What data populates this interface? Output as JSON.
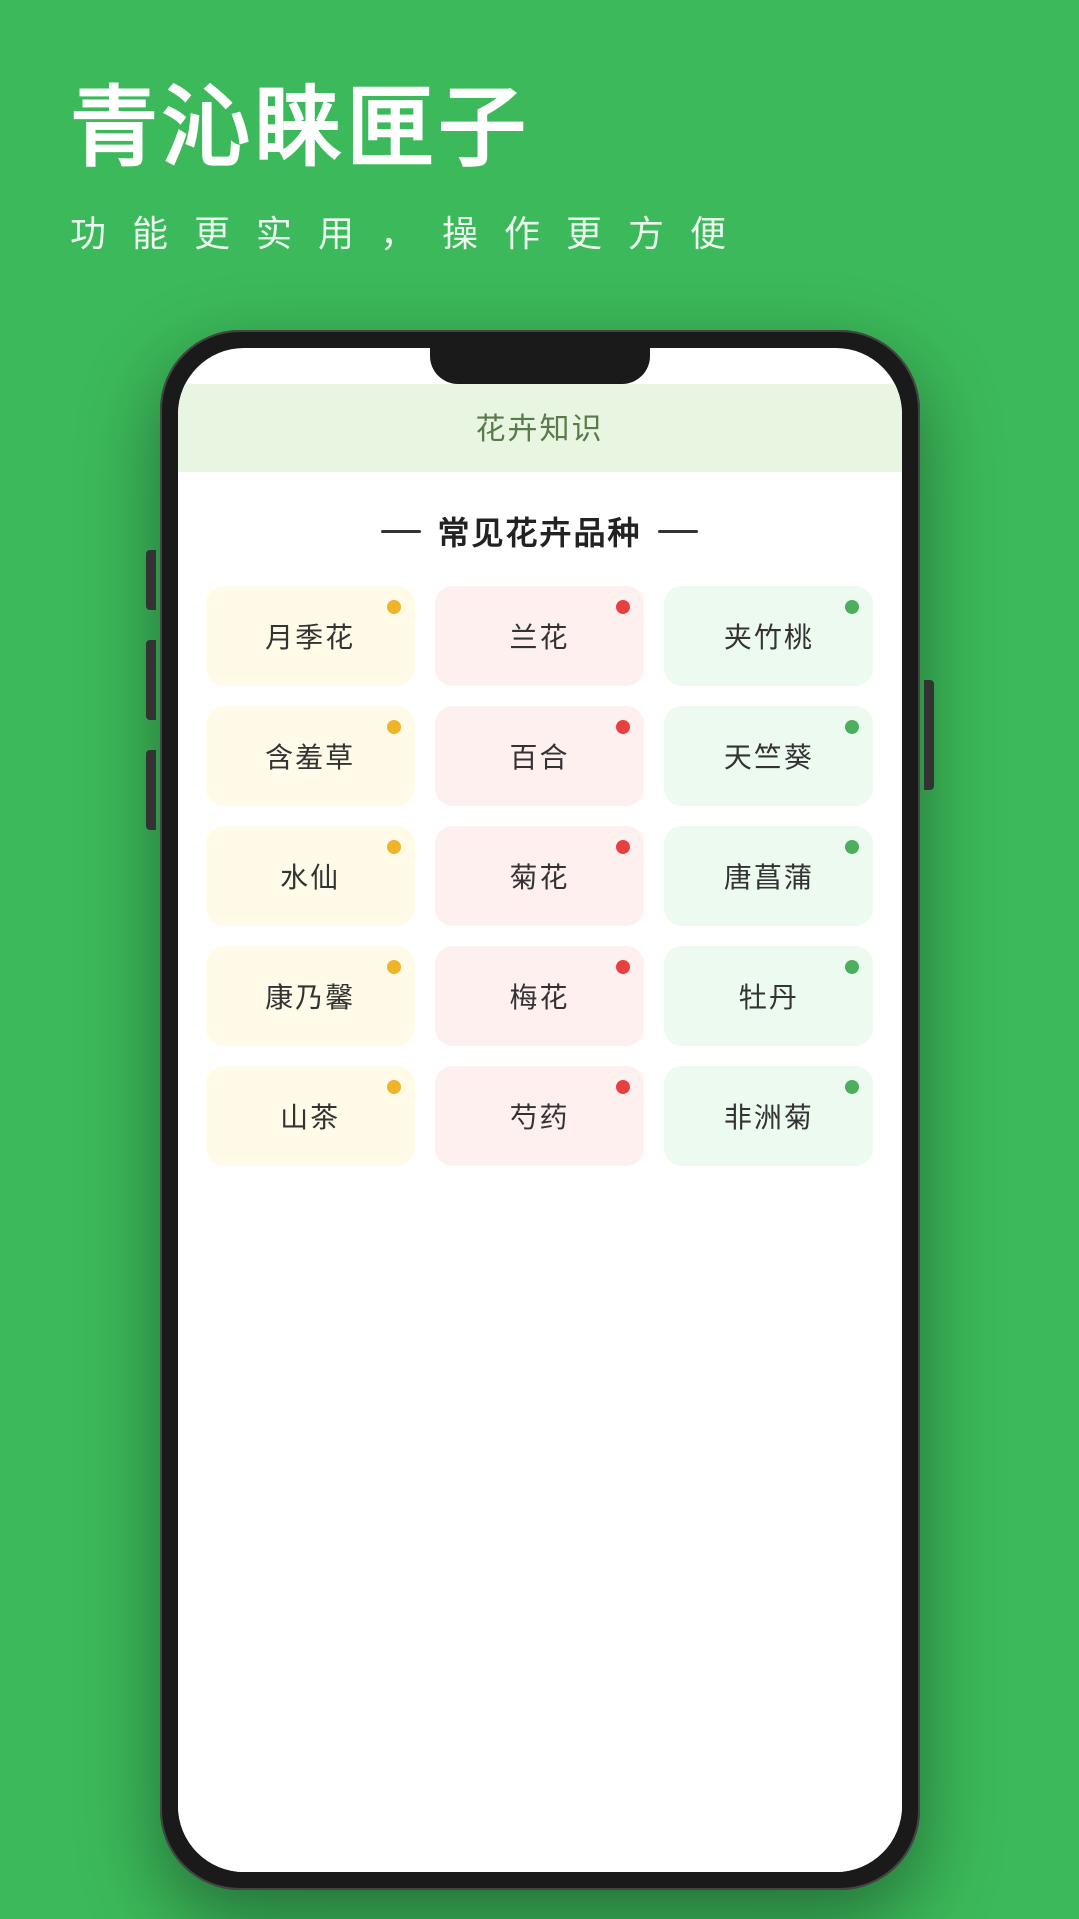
{
  "app": {
    "title": "青沁睐匣子",
    "subtitle": "功 能 更 实 用 ， 操 作 更 方 便"
  },
  "screen": {
    "header_title": "花卉知识",
    "section_title": "常见花卉品种",
    "flowers": [
      {
        "name": "月季花",
        "color": "yellow",
        "dot": "yellow"
      },
      {
        "name": "兰花",
        "color": "pink",
        "dot": "red"
      },
      {
        "name": "夹竹桃",
        "color": "green",
        "dot": "green"
      },
      {
        "name": "含羞草",
        "color": "yellow",
        "dot": "yellow"
      },
      {
        "name": "百合",
        "color": "pink",
        "dot": "red"
      },
      {
        "name": "天竺葵",
        "color": "green",
        "dot": "green"
      },
      {
        "name": "水仙",
        "color": "yellow",
        "dot": "yellow"
      },
      {
        "name": "菊花",
        "color": "pink",
        "dot": "red"
      },
      {
        "name": "唐菖蒲",
        "color": "green",
        "dot": "green"
      },
      {
        "name": "康乃馨",
        "color": "yellow",
        "dot": "yellow"
      },
      {
        "name": "梅花",
        "color": "pink",
        "dot": "red"
      },
      {
        "name": "牡丹",
        "color": "green",
        "dot": "green"
      },
      {
        "name": "山茶",
        "color": "yellow",
        "dot": "yellow"
      },
      {
        "name": "芍药",
        "color": "pink",
        "dot": "red"
      },
      {
        "name": "非洲菊",
        "color": "green",
        "dot": "green"
      }
    ]
  }
}
